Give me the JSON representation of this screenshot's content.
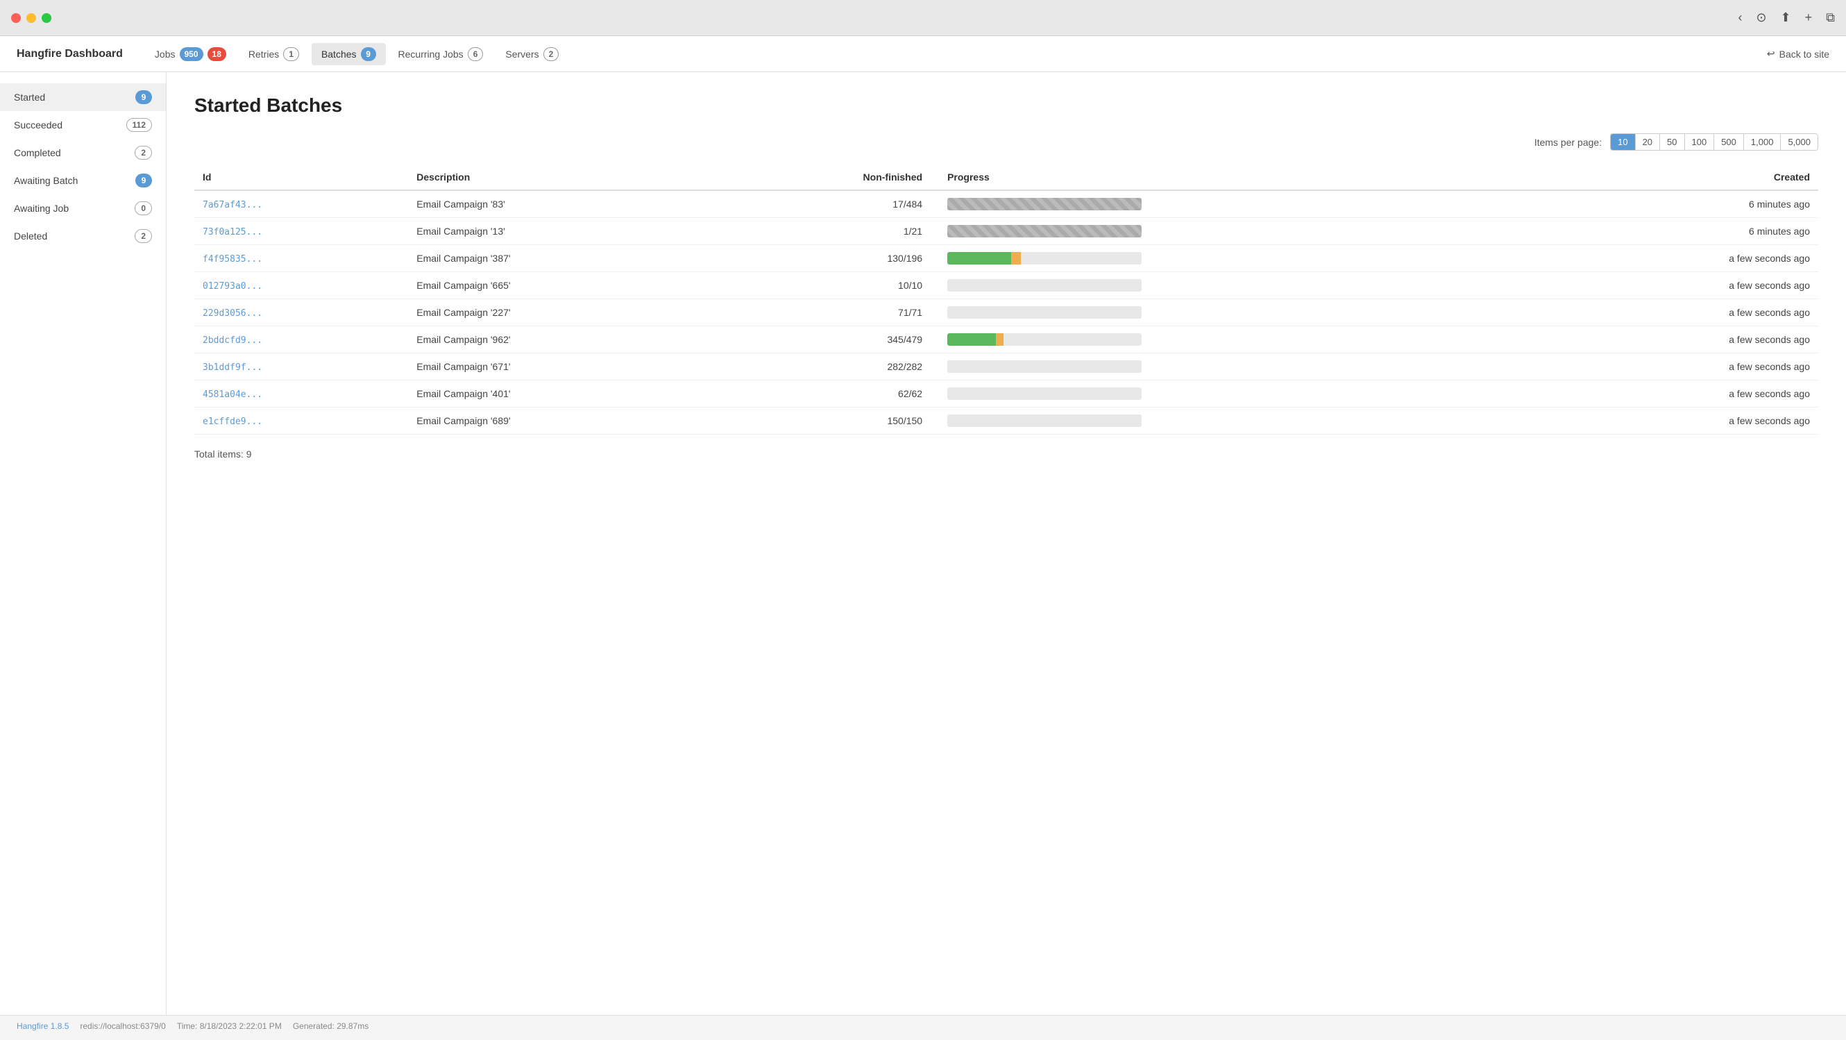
{
  "titlebar": {
    "traffic_lights": [
      "red",
      "yellow",
      "green"
    ],
    "controls": [
      "‹",
      "⊙",
      "⬆",
      "+",
      "⧉"
    ]
  },
  "navbar": {
    "brand": "Hangfire Dashboard",
    "items": [
      {
        "label": "Jobs",
        "badge": "950",
        "badge2": "18",
        "badge_type": "blue",
        "badge2_type": "red",
        "active": false
      },
      {
        "label": "Retries",
        "badge": "1",
        "badge_type": "outline",
        "active": false
      },
      {
        "label": "Batches",
        "badge": "9",
        "badge_type": "blue",
        "active": true
      },
      {
        "label": "Recurring Jobs",
        "badge": "6",
        "badge_type": "outline",
        "active": false
      },
      {
        "label": "Servers",
        "badge": "2",
        "badge_type": "outline",
        "active": false
      }
    ],
    "back_label": "Back to site"
  },
  "sidebar": {
    "items": [
      {
        "label": "Started",
        "badge": "9",
        "badge_type": "blue",
        "active": true
      },
      {
        "label": "Succeeded",
        "badge": "112",
        "badge_type": "outline",
        "active": false
      },
      {
        "label": "Completed",
        "badge": "2",
        "badge_type": "outline",
        "active": false
      },
      {
        "label": "Awaiting Batch",
        "badge": "9",
        "badge_type": "blue",
        "active": false
      },
      {
        "label": "Awaiting Job",
        "badge": "0",
        "badge_type": "outline",
        "active": false
      },
      {
        "label": "Deleted",
        "badge": "2",
        "badge_type": "outline",
        "active": false
      }
    ]
  },
  "main": {
    "page_title": "Started Batches",
    "ipp_label": "Items per page:",
    "ipp_options": [
      "10",
      "20",
      "50",
      "100",
      "500",
      "1,000",
      "5,000"
    ],
    "ipp_active": "10",
    "table": {
      "headers": [
        "Id",
        "Description",
        "Non-finished",
        "Progress",
        "Created"
      ],
      "rows": [
        {
          "id": "7a67af43...",
          "description": "Email Campaign '83'",
          "non_finished": "17/484",
          "progress_green": 97,
          "progress_orange": 0,
          "progress_type": "striped",
          "created": "6 minutes ago"
        },
        {
          "id": "73f0a125...",
          "description": "Email Campaign '13'",
          "non_finished": "1/21",
          "progress_green": 95,
          "progress_orange": 0,
          "progress_type": "striped",
          "created": "6 minutes ago"
        },
        {
          "id": "f4f95835...",
          "description": "Email Campaign '387'",
          "non_finished": "130/196",
          "progress_green": 33,
          "progress_orange": 5,
          "progress_type": "partial",
          "created": "a few seconds ago"
        },
        {
          "id": "012793a0...",
          "description": "Email Campaign '665'",
          "non_finished": "10/10",
          "progress_green": 0,
          "progress_orange": 0,
          "progress_type": "empty",
          "created": "a few seconds ago"
        },
        {
          "id": "229d3056...",
          "description": "Email Campaign '227'",
          "non_finished": "71/71",
          "progress_green": 0,
          "progress_orange": 0,
          "progress_type": "empty",
          "created": "a few seconds ago"
        },
        {
          "id": "2bddcfd9...",
          "description": "Email Campaign '962'",
          "non_finished": "345/479",
          "progress_green": 25,
          "progress_orange": 4,
          "progress_type": "partial",
          "created": "a few seconds ago"
        },
        {
          "id": "3b1ddf9f...",
          "description": "Email Campaign '671'",
          "non_finished": "282/282",
          "progress_green": 0,
          "progress_orange": 0,
          "progress_type": "empty",
          "created": "a few seconds ago"
        },
        {
          "id": "4581a04e...",
          "description": "Email Campaign '401'",
          "non_finished": "62/62",
          "progress_green": 0,
          "progress_orange": 0,
          "progress_type": "empty",
          "created": "a few seconds ago"
        },
        {
          "id": "e1cffde9...",
          "description": "Email Campaign '689'",
          "non_finished": "150/150",
          "progress_green": 0,
          "progress_orange": 0,
          "progress_type": "empty",
          "created": "a few seconds ago"
        }
      ]
    },
    "total_items_label": "Total items: 9"
  },
  "footer": {
    "version_link": "Hangfire 1.8.5",
    "redis": "redis://localhost:6379/0",
    "time_label": "Time:",
    "time_value": "8/18/2023 2:22:01 PM",
    "generated_label": "Generated:",
    "generated_value": "29.87ms"
  }
}
